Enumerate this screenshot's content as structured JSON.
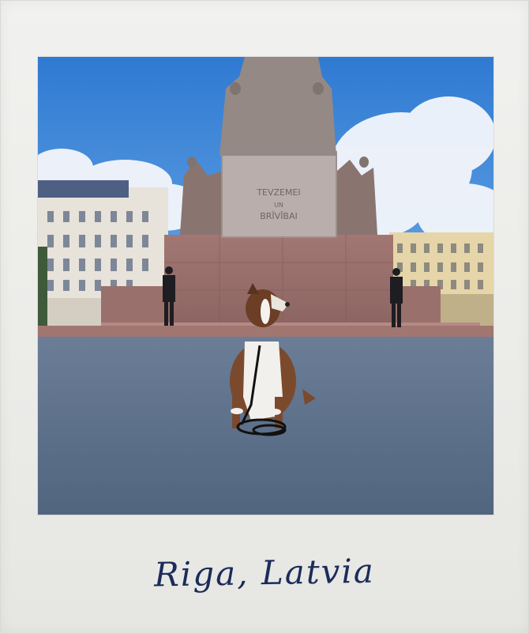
{
  "photo": {
    "description_icon": "photo-icon",
    "monument_inscription": [
      "TEVZEMEI",
      "UN",
      "BRĪVĪBAI"
    ]
  },
  "caption": {
    "text": "Riga, Latvia"
  },
  "colors": {
    "frame": "#eeeeeb",
    "sky": "#3d86d6",
    "pavement": "#5b6f8c",
    "caption_ink": "#1c2b5a"
  }
}
